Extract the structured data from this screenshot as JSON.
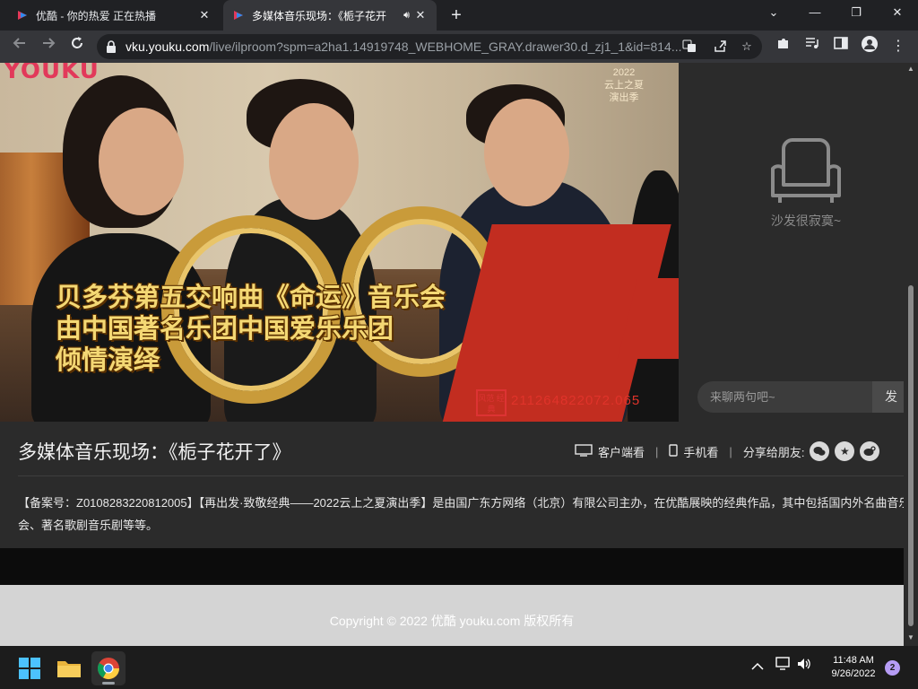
{
  "browser": {
    "tabs": [
      {
        "title": "优酷 - 你的热爱 正在热播",
        "active": false
      },
      {
        "title": "多媒体音乐现场：《栀子花开",
        "active": true,
        "audio": true
      }
    ],
    "url_host": "vku.youku.com",
    "url_path": "/live/ilproom?spm=a2ha1.14919748_WEBHOME_GRAY.drawer30.d_zj1_1&id=814...",
    "new_tab_symbol": "+",
    "window_controls": {
      "minimize": "—",
      "restore": "❐",
      "close": "✕",
      "tab_list": "⌄"
    }
  },
  "video": {
    "logo_text": "YOUKU",
    "badge_year": "2022",
    "badge_line1": "云上之夏",
    "badge_line2": "演出季",
    "caption_lines": [
      "贝多芬第五交响曲《命运》音乐会",
      "由中国著名乐团中国爱乐乐团",
      "倾情演绎"
    ],
    "watermark": "211264822072.065",
    "seal_text": "风范 经典"
  },
  "sidebar": {
    "empty_text": "沙发很寂寞~",
    "chat_placeholder": "来聊两句吧~",
    "send_label": "发"
  },
  "info": {
    "title": "多媒体音乐现场：《栀子花开了》",
    "client_watch": "客户端看",
    "mobile_watch": "手机看",
    "share_label": "分享给朋友:",
    "share_icons": [
      "wechat-icon",
      "qzone-icon",
      "weibo-icon"
    ],
    "description": "【备案号：Z0108283220812005】【再出发·致敬经典——2022云上之夏演出季】是由国广东方网络（北京）有限公司主办，在优酷展映的经典作品，其中包括国内外名曲音乐会、著名歌剧音乐剧等等。"
  },
  "footer": {
    "copyright": "Copyright © 2022 优酷 youku.com 版权所有"
  },
  "taskbar": {
    "time": "11:48 AM",
    "date": "9/26/2022",
    "notification_count": "2"
  },
  "colors": {
    "chrome_dark": "#202124",
    "toolbar": "#35363a",
    "page_bg": "#2b2b2b",
    "caption_gold": "#f4d874",
    "youku_pink": "#e2395a"
  }
}
